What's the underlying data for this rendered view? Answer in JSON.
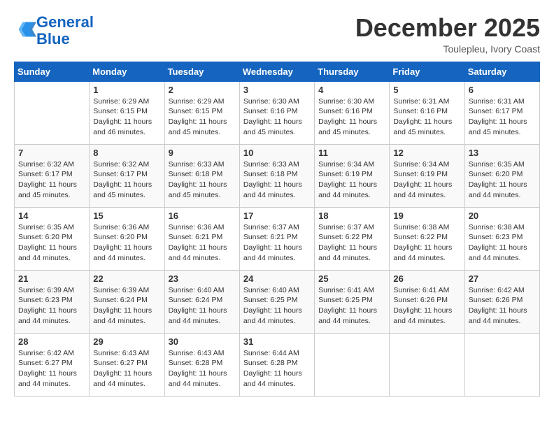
{
  "logo": {
    "line1": "General",
    "line2": "Blue"
  },
  "title": "December 2025",
  "subtitle": "Toulepleu, Ivory Coast",
  "days_of_week": [
    "Sunday",
    "Monday",
    "Tuesday",
    "Wednesday",
    "Thursday",
    "Friday",
    "Saturday"
  ],
  "weeks": [
    [
      {
        "day": "",
        "info": ""
      },
      {
        "day": "1",
        "info": "Sunrise: 6:29 AM\nSunset: 6:15 PM\nDaylight: 11 hours\nand 46 minutes."
      },
      {
        "day": "2",
        "info": "Sunrise: 6:29 AM\nSunset: 6:15 PM\nDaylight: 11 hours\nand 45 minutes."
      },
      {
        "day": "3",
        "info": "Sunrise: 6:30 AM\nSunset: 6:16 PM\nDaylight: 11 hours\nand 45 minutes."
      },
      {
        "day": "4",
        "info": "Sunrise: 6:30 AM\nSunset: 6:16 PM\nDaylight: 11 hours\nand 45 minutes."
      },
      {
        "day": "5",
        "info": "Sunrise: 6:31 AM\nSunset: 6:16 PM\nDaylight: 11 hours\nand 45 minutes."
      },
      {
        "day": "6",
        "info": "Sunrise: 6:31 AM\nSunset: 6:17 PM\nDaylight: 11 hours\nand 45 minutes."
      }
    ],
    [
      {
        "day": "7",
        "info": "Sunrise: 6:32 AM\nSunset: 6:17 PM\nDaylight: 11 hours\nand 45 minutes."
      },
      {
        "day": "8",
        "info": "Sunrise: 6:32 AM\nSunset: 6:17 PM\nDaylight: 11 hours\nand 45 minutes."
      },
      {
        "day": "9",
        "info": "Sunrise: 6:33 AM\nSunset: 6:18 PM\nDaylight: 11 hours\nand 45 minutes."
      },
      {
        "day": "10",
        "info": "Sunrise: 6:33 AM\nSunset: 6:18 PM\nDaylight: 11 hours\nand 44 minutes."
      },
      {
        "day": "11",
        "info": "Sunrise: 6:34 AM\nSunset: 6:19 PM\nDaylight: 11 hours\nand 44 minutes."
      },
      {
        "day": "12",
        "info": "Sunrise: 6:34 AM\nSunset: 6:19 PM\nDaylight: 11 hours\nand 44 minutes."
      },
      {
        "day": "13",
        "info": "Sunrise: 6:35 AM\nSunset: 6:20 PM\nDaylight: 11 hours\nand 44 minutes."
      }
    ],
    [
      {
        "day": "14",
        "info": "Sunrise: 6:35 AM\nSunset: 6:20 PM\nDaylight: 11 hours\nand 44 minutes."
      },
      {
        "day": "15",
        "info": "Sunrise: 6:36 AM\nSunset: 6:20 PM\nDaylight: 11 hours\nand 44 minutes."
      },
      {
        "day": "16",
        "info": "Sunrise: 6:36 AM\nSunset: 6:21 PM\nDaylight: 11 hours\nand 44 minutes."
      },
      {
        "day": "17",
        "info": "Sunrise: 6:37 AM\nSunset: 6:21 PM\nDaylight: 11 hours\nand 44 minutes."
      },
      {
        "day": "18",
        "info": "Sunrise: 6:37 AM\nSunset: 6:22 PM\nDaylight: 11 hours\nand 44 minutes."
      },
      {
        "day": "19",
        "info": "Sunrise: 6:38 AM\nSunset: 6:22 PM\nDaylight: 11 hours\nand 44 minutes."
      },
      {
        "day": "20",
        "info": "Sunrise: 6:38 AM\nSunset: 6:23 PM\nDaylight: 11 hours\nand 44 minutes."
      }
    ],
    [
      {
        "day": "21",
        "info": "Sunrise: 6:39 AM\nSunset: 6:23 PM\nDaylight: 11 hours\nand 44 minutes."
      },
      {
        "day": "22",
        "info": "Sunrise: 6:39 AM\nSunset: 6:24 PM\nDaylight: 11 hours\nand 44 minutes."
      },
      {
        "day": "23",
        "info": "Sunrise: 6:40 AM\nSunset: 6:24 PM\nDaylight: 11 hours\nand 44 minutes."
      },
      {
        "day": "24",
        "info": "Sunrise: 6:40 AM\nSunset: 6:25 PM\nDaylight: 11 hours\nand 44 minutes."
      },
      {
        "day": "25",
        "info": "Sunrise: 6:41 AM\nSunset: 6:25 PM\nDaylight: 11 hours\nand 44 minutes."
      },
      {
        "day": "26",
        "info": "Sunrise: 6:41 AM\nSunset: 6:26 PM\nDaylight: 11 hours\nand 44 minutes."
      },
      {
        "day": "27",
        "info": "Sunrise: 6:42 AM\nSunset: 6:26 PM\nDaylight: 11 hours\nand 44 minutes."
      }
    ],
    [
      {
        "day": "28",
        "info": "Sunrise: 6:42 AM\nSunset: 6:27 PM\nDaylight: 11 hours\nand 44 minutes."
      },
      {
        "day": "29",
        "info": "Sunrise: 6:43 AM\nSunset: 6:27 PM\nDaylight: 11 hours\nand 44 minutes."
      },
      {
        "day": "30",
        "info": "Sunrise: 6:43 AM\nSunset: 6:28 PM\nDaylight: 11 hours\nand 44 minutes."
      },
      {
        "day": "31",
        "info": "Sunrise: 6:44 AM\nSunset: 6:28 PM\nDaylight: 11 hours\nand 44 minutes."
      },
      {
        "day": "",
        "info": ""
      },
      {
        "day": "",
        "info": ""
      },
      {
        "day": "",
        "info": ""
      }
    ]
  ]
}
